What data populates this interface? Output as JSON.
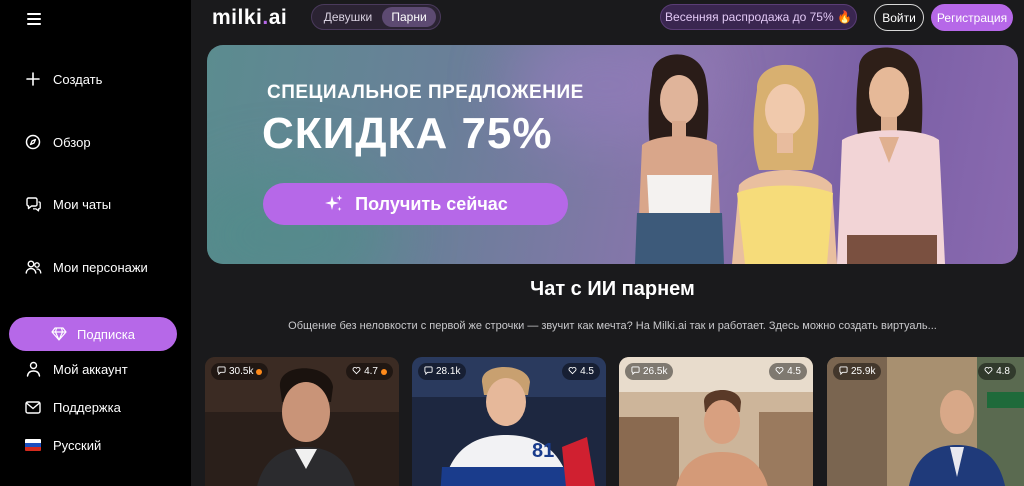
{
  "header": {
    "logo_main": "milki",
    "logo_dot": ".",
    "logo_ai": "ai",
    "tabs": [
      "Девушки",
      "Парни"
    ],
    "active_tab": "Парни",
    "sale_text": "Весенняя распродажа до 75% 🔥",
    "login_label": "Войти",
    "register_label": "Регистрация"
  },
  "sidebar": {
    "items": [
      {
        "label": "Создать",
        "icon": "plus-icon"
      },
      {
        "label": "Обзор",
        "icon": "compass-icon"
      },
      {
        "label": "Мои чаты",
        "icon": "chat-icon"
      },
      {
        "label": "Мои персонажи",
        "icon": "users-icon"
      }
    ],
    "subscription_label": "Подписка",
    "bottom_items": [
      {
        "label": "Мой аккаунт",
        "icon": "user-icon"
      },
      {
        "label": "Поддержка",
        "icon": "mail-icon"
      },
      {
        "label": "Русский",
        "icon": "russia-flag-icon"
      }
    ]
  },
  "banner": {
    "subtitle": "СПЕЦИАЛЬНОЕ ПРЕДЛОЖЕНИЕ",
    "title": "СКИДКА 75%",
    "cta_label": "Получить сейчас"
  },
  "section": {
    "title": "Чат с ИИ парнем",
    "description": "Общение без неловкости с первой же строчки — звучит как мечта? На Milki.ai так и работает. Здесь можно создать виртуаль..."
  },
  "cards": [
    {
      "chats": "30.5k",
      "rating": "4.7",
      "hot": true
    },
    {
      "chats": "28.1k",
      "rating": "4.5",
      "hot": false
    },
    {
      "chats": "26.5k",
      "rating": "4.5",
      "hot": false
    },
    {
      "chats": "25.9k",
      "rating": "4.8",
      "hot": false
    }
  ],
  "colors": {
    "accent": "#b668e8",
    "sidebar_bg": "#000000",
    "page_bg": "#1a1a1c"
  }
}
